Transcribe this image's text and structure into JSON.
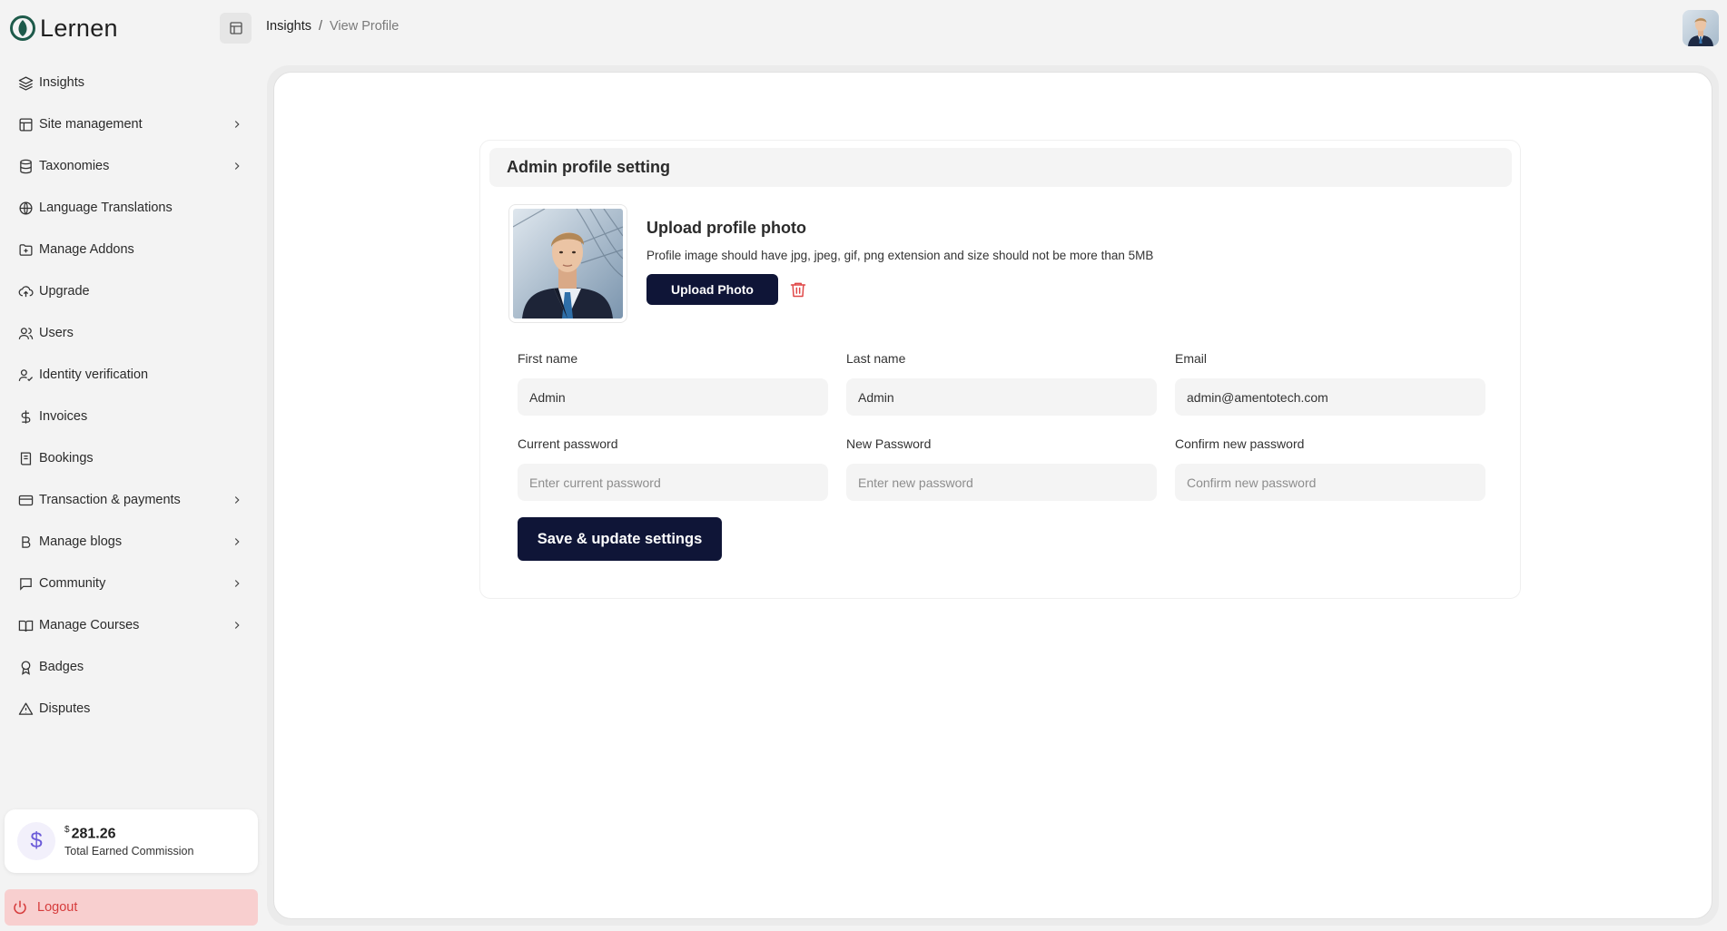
{
  "brand": {
    "name": "Lernen"
  },
  "breadcrumb": {
    "parent": "Insights",
    "separator": "/",
    "current": "View Profile"
  },
  "sidebar": {
    "items": [
      {
        "label": "Insights",
        "icon": "layers-icon",
        "has_submenu": false
      },
      {
        "label": "Site management",
        "icon": "layout-icon",
        "has_submenu": true
      },
      {
        "label": "Taxonomies",
        "icon": "database-icon",
        "has_submenu": true
      },
      {
        "label": "Language Translations",
        "icon": "globe-icon",
        "has_submenu": false
      },
      {
        "label": "Manage Addons",
        "icon": "folder-plus-icon",
        "has_submenu": false
      },
      {
        "label": "Upgrade",
        "icon": "cloud-upload-icon",
        "has_submenu": false
      },
      {
        "label": "Users",
        "icon": "users-icon",
        "has_submenu": false
      },
      {
        "label": "Identity verification",
        "icon": "user-check-icon",
        "has_submenu": false
      },
      {
        "label": "Invoices",
        "icon": "dollar-icon",
        "has_submenu": false
      },
      {
        "label": "Bookings",
        "icon": "book-icon",
        "has_submenu": false
      },
      {
        "label": "Transaction & payments",
        "icon": "credit-card-icon",
        "has_submenu": true
      },
      {
        "label": "Manage blogs",
        "icon": "bold-icon",
        "has_submenu": true
      },
      {
        "label": "Community",
        "icon": "chat-icon",
        "has_submenu": true
      },
      {
        "label": "Manage Courses",
        "icon": "open-book-icon",
        "has_submenu": true
      },
      {
        "label": "Badges",
        "icon": "award-icon",
        "has_submenu": false
      },
      {
        "label": "Disputes",
        "icon": "alert-triangle-icon",
        "has_submenu": false
      }
    ],
    "commission": {
      "currency": "$",
      "amount": "281.26",
      "label": "Total Earned Commission"
    },
    "logout_label": "Logout"
  },
  "profile": {
    "header": "Admin profile setting",
    "upload_title": "Upload profile photo",
    "upload_hint": "Profile image should have jpg, jpeg, gif, png extension and size should not be more than 5MB",
    "upload_button": "Upload Photo",
    "fields": {
      "first_name": {
        "label": "First name",
        "value": "Admin",
        "placeholder": ""
      },
      "last_name": {
        "label": "Last name",
        "value": "Admin",
        "placeholder": ""
      },
      "email": {
        "label": "Email",
        "value": "admin@amentotech.com",
        "placeholder": ""
      },
      "current_password": {
        "label": "Current password",
        "value": "",
        "placeholder": "Enter current password"
      },
      "new_password": {
        "label": "New Password",
        "value": "",
        "placeholder": "Enter new password"
      },
      "confirm_password": {
        "label": "Confirm new password",
        "value": "",
        "placeholder": "Confirm new password"
      }
    },
    "save_button": "Save & update settings"
  },
  "colors": {
    "primary_dark": "#0f1537",
    "logout_bg": "#f8cfcf",
    "logout_text": "#d63c3c",
    "delete_red": "#e04848",
    "brand_green": "#1d5a4a"
  }
}
